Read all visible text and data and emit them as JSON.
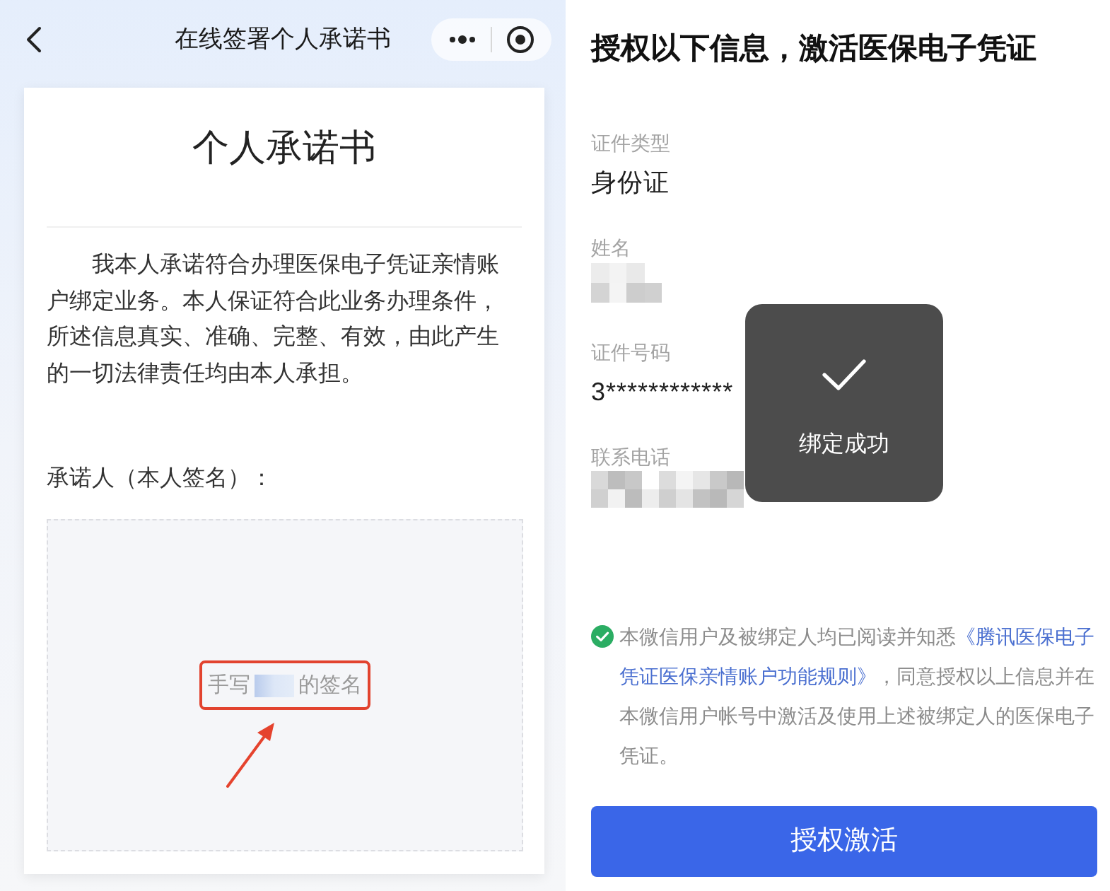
{
  "left": {
    "nav": {
      "title": "在线签署个人承诺书"
    },
    "document": {
      "title": "个人承诺书",
      "body": "我本人承诺符合办理医保电子凭证亲情账户绑定业务。本人保证符合此业务办理条件，所述信息真实、准确、完整、有效，由此产生的一切法律责任均由本人承担。",
      "signer_label": "承诺人（本人签名）：",
      "signature_hint": {
        "before": "手写",
        "after": "的签名"
      }
    }
  },
  "right": {
    "title": "授权以下信息，激活医保电子凭证",
    "fields": [
      {
        "label": "证件类型",
        "kind": "text",
        "value": "身份证"
      },
      {
        "label": "姓名",
        "kind": "mosaic"
      },
      {
        "label": "证件号码",
        "kind": "text",
        "value": "3************"
      },
      {
        "label": "联系电话",
        "kind": "mosaic"
      }
    ],
    "consent": {
      "checked": true,
      "text_before": "本微信用户及被绑定人均已阅读并知悉",
      "link_lines": [
        "《腾讯医保电子",
        "凭证医保亲情账户功能规则》"
      ],
      "text_after": "，同意授权以上信息并在本微信用户帐号中激活及使用上述被绑定人的医保电子凭证。"
    },
    "button": "授权激活",
    "toast": {
      "message": "绑定成功"
    }
  }
}
